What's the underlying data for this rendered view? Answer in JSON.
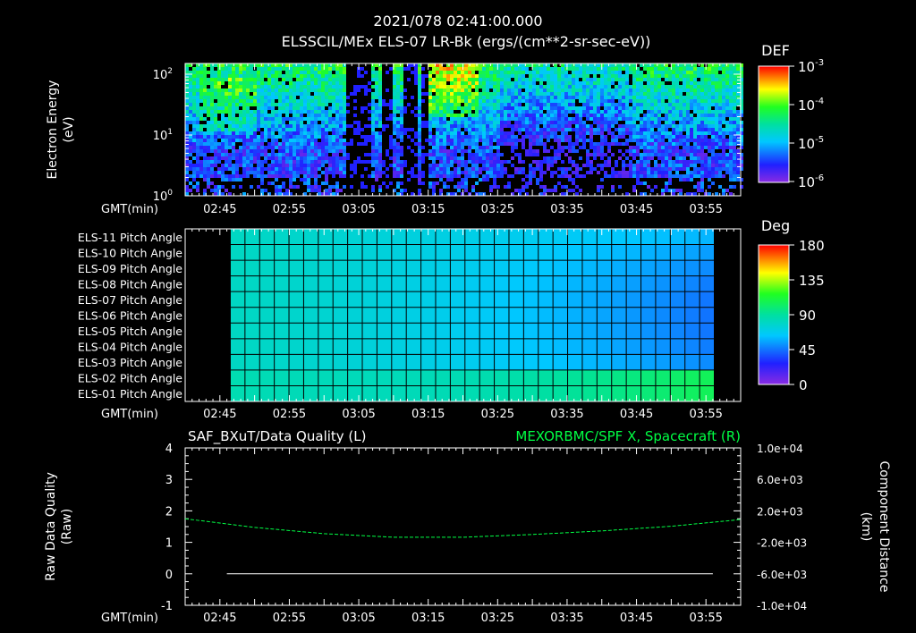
{
  "header": {
    "timestamp": "2021/078 02:41:00.000",
    "title": "ELSSCIL/MEx ELS-07 LR-Bk  (ergs/(cm**2-sr-sec-eV))"
  },
  "time_label": "GMT(min)",
  "colors": {
    "background": "#000000",
    "foreground": "#ffffff",
    "series_green": "#00ff44"
  },
  "chart_data": [
    {
      "type": "heatmap",
      "name": "spectrogram",
      "ylabel": "Electron Energy\n(eV)",
      "yscale": "log",
      "ylim": [
        1,
        150
      ],
      "y_ticks": [
        "10^0",
        "10^1",
        "10^2"
      ],
      "x_ticks": [
        "02:45",
        "02:55",
        "03:05",
        "03:15",
        "03:25",
        "03:35",
        "03:45",
        "03:55"
      ],
      "colorbar": {
        "label": "DEF",
        "ticks": [
          "10^-3",
          "10^-4",
          "10^-5",
          "10^-6"
        ]
      }
    },
    {
      "type": "heatmap",
      "name": "pitch-angle",
      "row_labels": [
        "ELS-11 Pitch Angle",
        "ELS-10 Pitch Angle",
        "ELS-09 Pitch Angle",
        "ELS-08 Pitch Angle",
        "ELS-07 Pitch Angle",
        "ELS-06 Pitch Angle",
        "ELS-05 Pitch Angle",
        "ELS-04 Pitch Angle",
        "ELS-03 Pitch Angle",
        "ELS-02 Pitch Angle",
        "ELS-01 Pitch Angle"
      ],
      "x_ticks": [
        "02:45",
        "02:55",
        "03:05",
        "03:15",
        "03:25",
        "03:35",
        "03:45",
        "03:55"
      ],
      "colorbar": {
        "label": "Deg",
        "ticks": [
          "180",
          "135",
          "90",
          "45",
          "0"
        ],
        "range": [
          0,
          180
        ]
      }
    },
    {
      "type": "line",
      "name": "data-quality",
      "title_left": "SAF_BXuT/Data Quality (L)",
      "title_right": "MEXORBMC/SPF X, Spacecraft (R)",
      "ylabel": "Raw Data Quality\n(Raw)",
      "ylabel_right": "Component Distance\n(km)",
      "ylim": [
        -1,
        4
      ],
      "y_ticks": [
        "4",
        "3",
        "2",
        "1",
        "0",
        "-1"
      ],
      "ylim_right": [
        -10000,
        10000
      ],
      "y_ticks_right": [
        "1.0e+04",
        "6.0e+03",
        "2.0e+03",
        "-2.0e+03",
        "-6.0e+03",
        "-1.0e+04"
      ],
      "x_ticks": [
        "02:45",
        "02:55",
        "03:05",
        "03:15",
        "03:25",
        "03:35",
        "03:45",
        "03:55"
      ],
      "series": [
        {
          "name": "SAF_BXuT/Data Quality",
          "axis": "left",
          "color": "#ffffff",
          "x": [
            "02:46",
            "03:56"
          ],
          "y": [
            0,
            0
          ]
        },
        {
          "name": "MEXORBMC/SPF X, Spacecraft",
          "axis": "right",
          "color": "#00ff44",
          "x": [
            "02:40",
            "02:50",
            "03:00",
            "03:10",
            "03:20",
            "03:30",
            "03:40",
            "03:50",
            "04:00"
          ],
          "y": [
            1000,
            -100,
            -900,
            -1350,
            -1350,
            -1000,
            -550,
            50,
            900
          ]
        }
      ]
    }
  ]
}
